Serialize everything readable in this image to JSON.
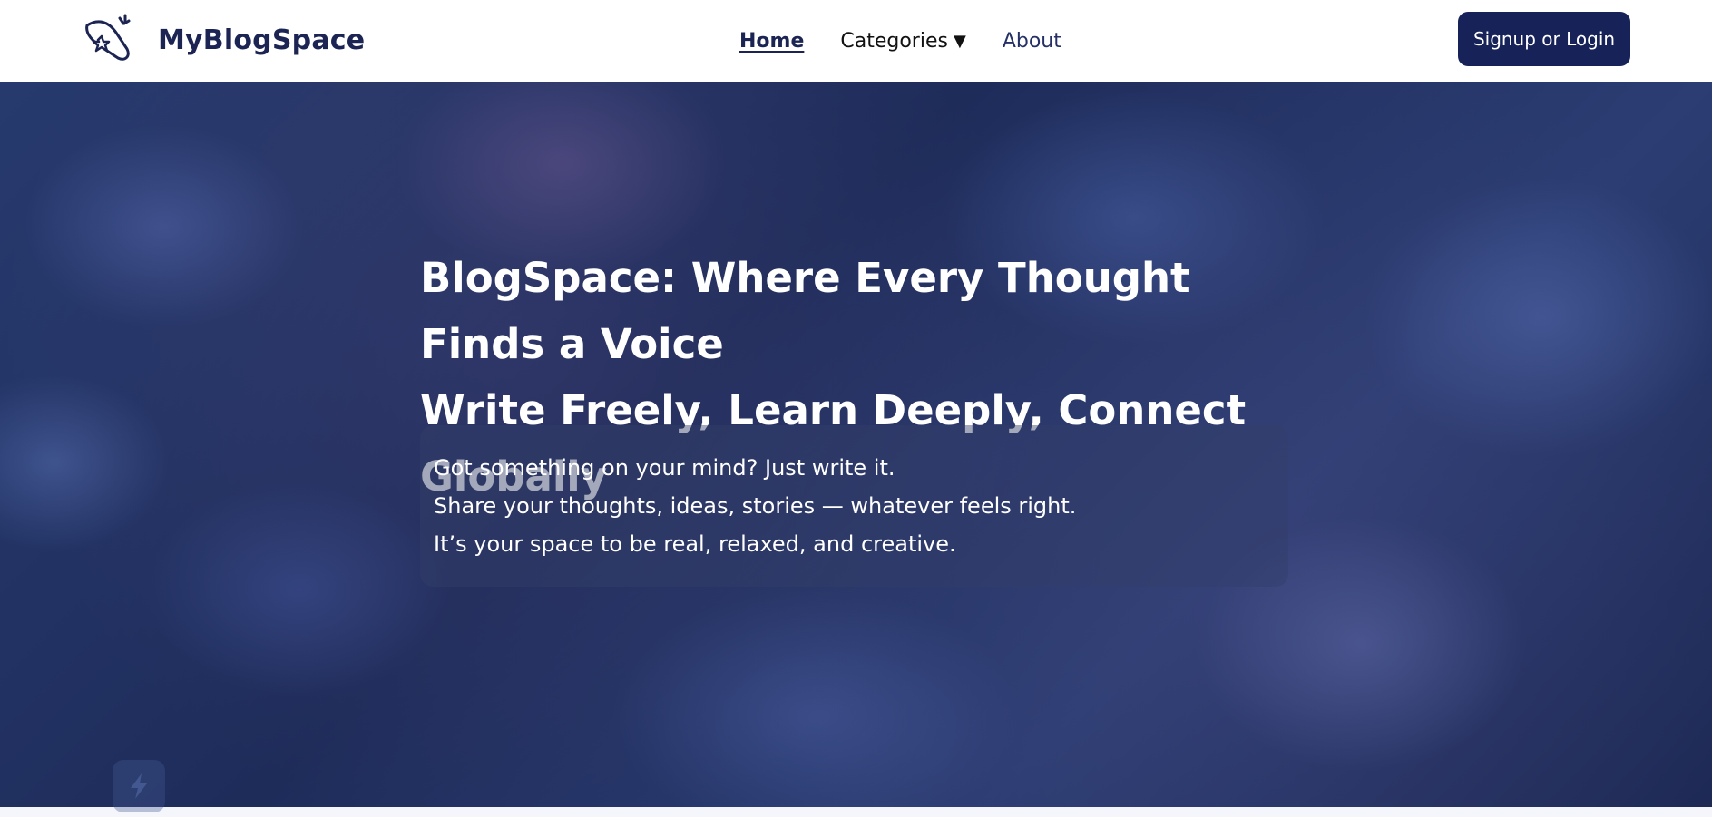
{
  "brand": {
    "name": "MyBlogSpace",
    "icon": "rocket-star-icon"
  },
  "nav": {
    "home": "Home",
    "categories": "Categories",
    "categories_caret": "▼",
    "about": "About"
  },
  "auth": {
    "login_label": "Signup or Login"
  },
  "hero": {
    "title_line1": "BlogSpace: Where Every Thought Finds a Voice",
    "title_line2": "Write Freely, Learn Deeply, Connect Globally",
    "description": [
      "Got something on your mind? Just write it.",
      "Share your thoughts, ideas, stories — whatever feels right.",
      "It’s your space to be real, relaxed, and creative."
    ]
  },
  "floating_badge": {
    "icon": "lightning-icon"
  },
  "colors": {
    "brand": "#1b2453",
    "button": "#172358",
    "hero_overlay": "#1e2c5a",
    "text_light": "#ffffff"
  }
}
